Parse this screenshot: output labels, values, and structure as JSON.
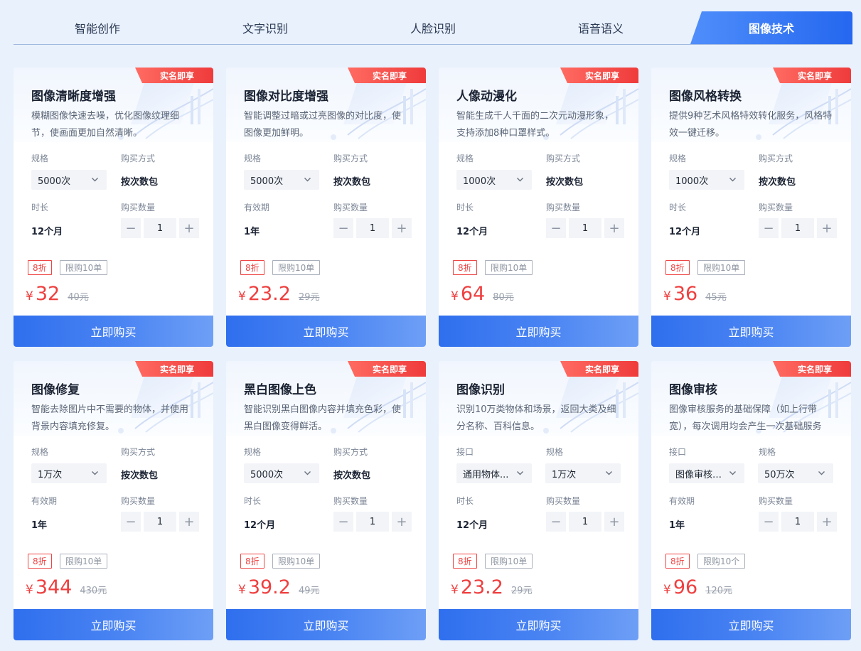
{
  "tabs": [
    "智能创作",
    "文字识别",
    "人脸识别",
    "语音语义",
    "图像技术"
  ],
  "active_tab": 4,
  "common": {
    "badge": "实名即享",
    "buy_label": "立即购买",
    "currency": "¥",
    "qty_label": "购买数量",
    "qty_value": "1",
    "minus": "−",
    "plus": "+"
  },
  "cards": [
    {
      "title": "图像清晰度增强",
      "desc": "模糊图像快速去噪，优化图像纹理细节，使画面更加自然清晰。",
      "f1_label": "规格",
      "f1_value": "5000次",
      "f1_type": "select",
      "f2_label": "购买方式",
      "f2_value": "按次数包",
      "f2_type": "text",
      "f3_label": "时长",
      "f3_value": "12个月",
      "discount": "8折",
      "limit": "限购10单",
      "price": "32",
      "orig": "40元"
    },
    {
      "title": "图像对比度增强",
      "desc": "智能调整过暗或过亮图像的对比度，使图像更加鲜明。",
      "f1_label": "规格",
      "f1_value": "5000次",
      "f1_type": "select",
      "f2_label": "购买方式",
      "f2_value": "按次数包",
      "f2_type": "text",
      "f3_label": "有效期",
      "f3_value": "1年",
      "discount": "8折",
      "limit": "限购10单",
      "price": "23.2",
      "orig": "29元"
    },
    {
      "title": "人像动漫化",
      "desc": "智能生成千人千面的二次元动漫形象，支持添加8种口罩样式。",
      "f1_label": "规格",
      "f1_value": "1000次",
      "f1_type": "select",
      "f2_label": "购买方式",
      "f2_value": "按次数包",
      "f2_type": "text",
      "f3_label": "时长",
      "f3_value": "12个月",
      "discount": "8折",
      "limit": "限购10单",
      "price": "64",
      "orig": "80元"
    },
    {
      "title": "图像风格转换",
      "desc": "提供9种艺术风格特效转化服务，风格特效一键迁移。",
      "f1_label": "规格",
      "f1_value": "1000次",
      "f1_type": "select",
      "f2_label": "购买方式",
      "f2_value": "按次数包",
      "f2_type": "text",
      "f3_label": "时长",
      "f3_value": "12个月",
      "discount": "8折",
      "limit": "限购10单",
      "price": "36",
      "orig": "45元"
    },
    {
      "title": "图像修复",
      "desc": "智能去除图片中不需要的物体，并使用背景内容填充修复。",
      "f1_label": "规格",
      "f1_value": "1万次",
      "f1_type": "select",
      "f2_label": "购买方式",
      "f2_value": "按次数包",
      "f2_type": "text",
      "f3_label": "有效期",
      "f3_value": "1年",
      "discount": "8折",
      "limit": "限购10单",
      "price": "344",
      "orig": "430元"
    },
    {
      "title": "黑白图像上色",
      "desc": "智能识别黑白图像内容并填充色彩，使黑白图像变得鲜活。",
      "f1_label": "规格",
      "f1_value": "5000次",
      "f1_type": "select",
      "f2_label": "购买方式",
      "f2_value": "按次数包",
      "f2_type": "text",
      "f3_label": "时长",
      "f3_value": "12个月",
      "discount": "8折",
      "limit": "限购10单",
      "price": "39.2",
      "orig": "49元"
    },
    {
      "title": "图像识别",
      "desc": "识别10万类物体和场景，返回大类及细分名称、百科信息。",
      "f1_label": "接口",
      "f1_value": "通用物体...",
      "f1_type": "select",
      "f2_label": "规格",
      "f2_value": "1万次",
      "f2_type": "select",
      "f3_label": "时长",
      "f3_value": "12个月",
      "discount": "8折",
      "limit": "限购10单",
      "price": "23.2",
      "orig": "29元"
    },
    {
      "title": "图像审核",
      "desc": "图像审核服务的基础保障（如上行带宽），每次调用均会产生一次基础服务费。",
      "f1_label": "接口",
      "f1_value": "图像审核-...",
      "f1_type": "select",
      "f2_label": "规格",
      "f2_value": "50万次",
      "f2_type": "select",
      "f3_label": "有效期",
      "f3_value": "1年",
      "discount": "8折",
      "limit": "限购10个",
      "price": "96",
      "orig": "120元"
    }
  ],
  "colors": {
    "accent": "#2f6fee",
    "discount_red": "#ef3f3f",
    "page_bg": "#e9f1fc"
  },
  "icons": {
    "select_arrow": "chevron-down-icon",
    "minus": "minus-icon",
    "plus": "plus-icon"
  }
}
